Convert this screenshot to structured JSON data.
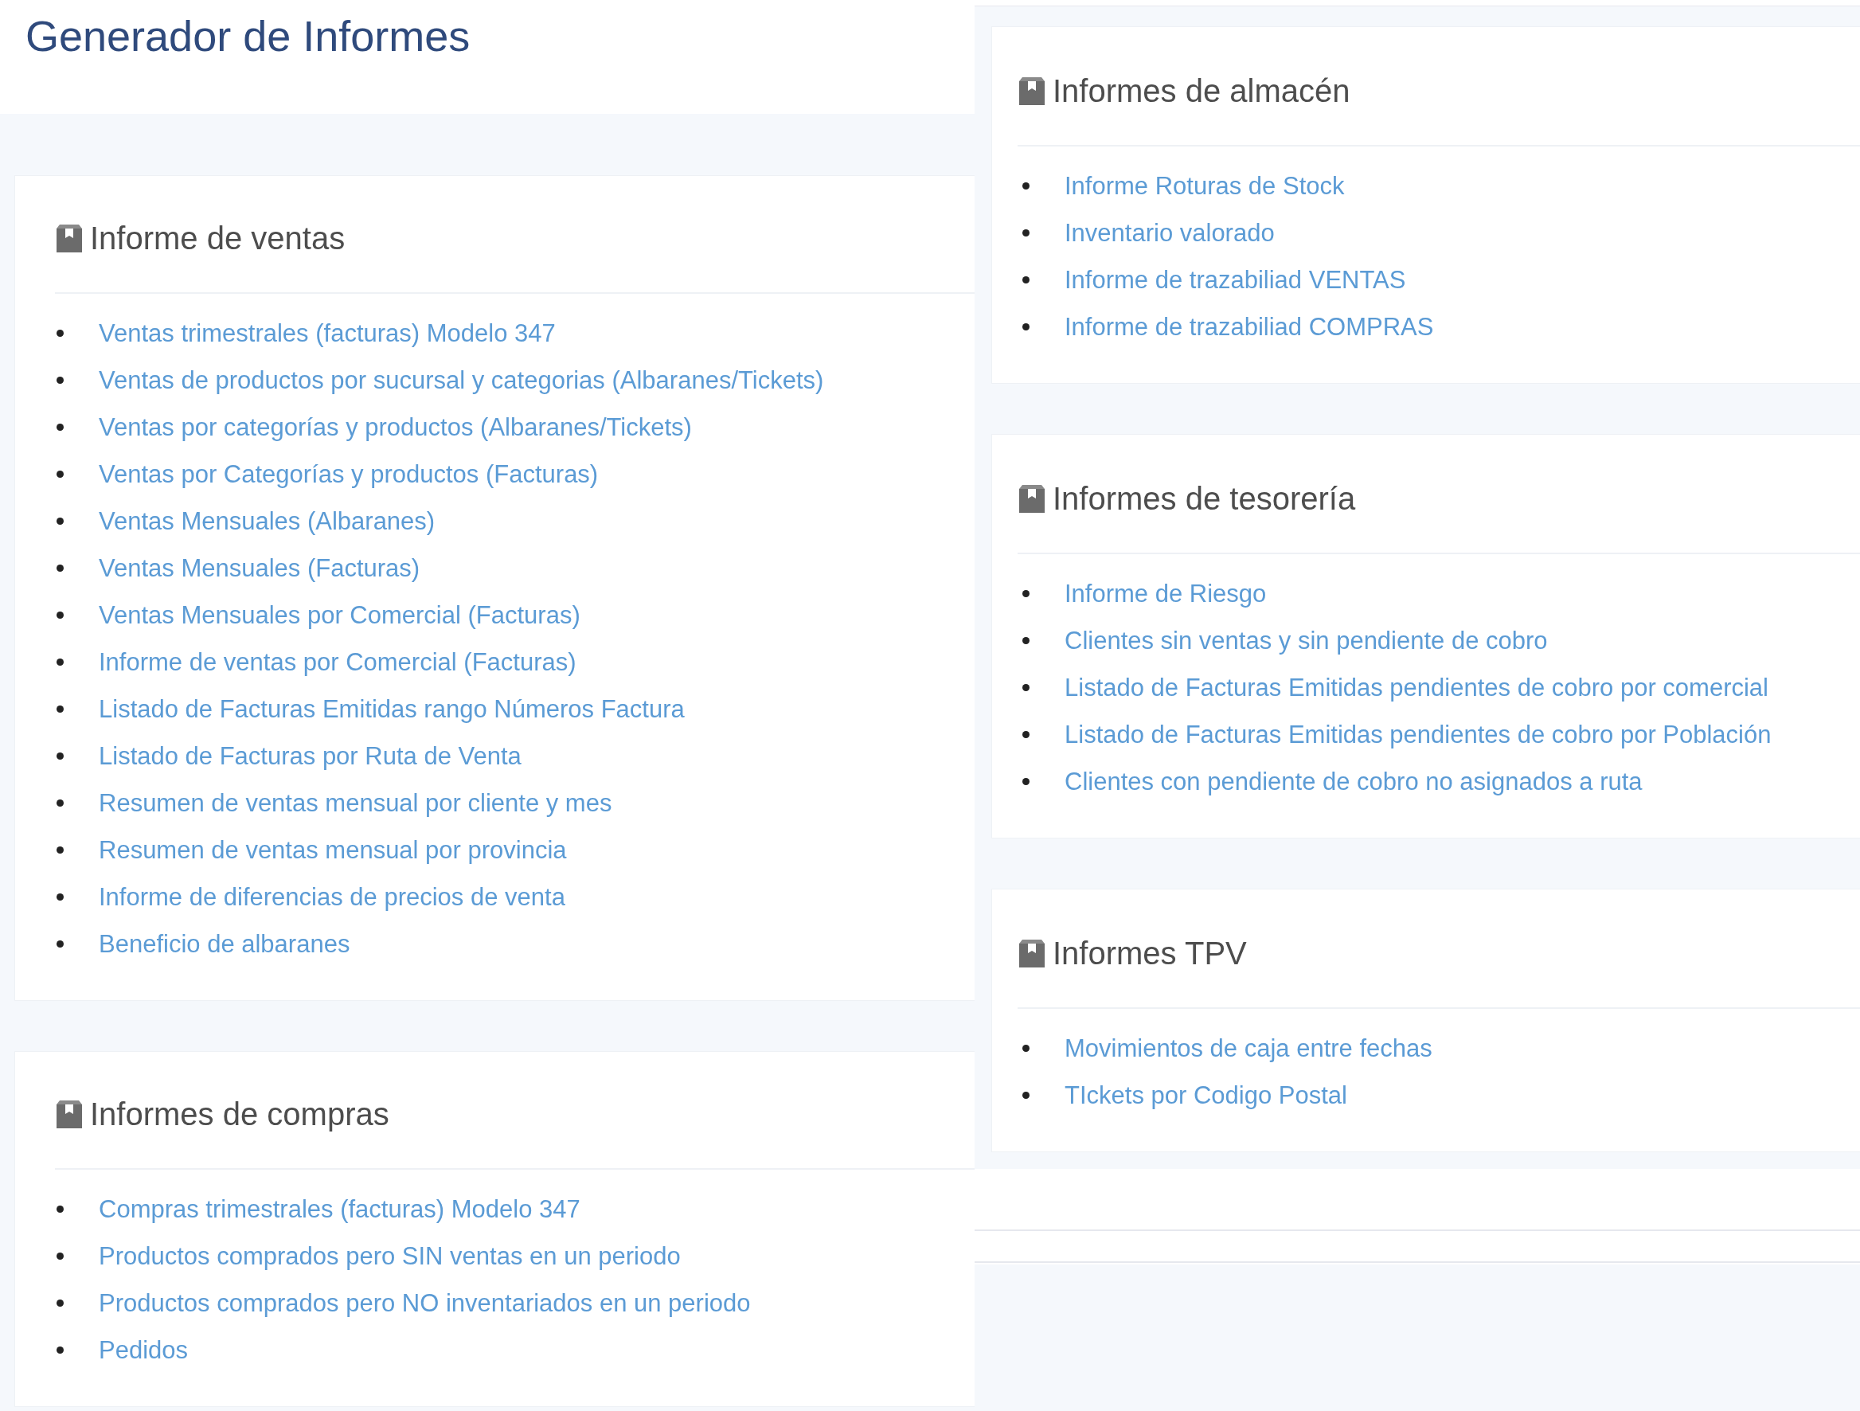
{
  "title": "Generador de Informes",
  "left_column": {
    "sections": [
      {
        "heading": "Informe de ventas",
        "links": [
          "Ventas trimestrales (facturas) Modelo 347",
          "Ventas de productos por sucursal y categorias (Albaranes/Tickets)",
          "Ventas por categorías y productos (Albaranes/Tickets)",
          "Ventas por Categorías y productos (Facturas)",
          "Ventas Mensuales (Albaranes)",
          "Ventas Mensuales (Facturas)",
          "Ventas Mensuales por Comercial (Facturas)",
          "Informe de ventas por Comercial (Facturas)",
          "Listado de Facturas Emitidas rango Números Factura",
          "Listado de Facturas por Ruta de Venta",
          "Resumen de ventas mensual por cliente y mes",
          "Resumen de ventas mensual por provincia",
          "Informe de diferencias de precios de venta",
          "Beneficio de albaranes"
        ]
      },
      {
        "heading": "Informes de compras",
        "links": [
          "Compras trimestrales (facturas) Modelo 347",
          "Productos comprados pero SIN ventas en un periodo",
          "Productos comprados pero NO inventariados en un periodo",
          "Pedidos"
        ]
      }
    ]
  },
  "right_column": {
    "sections": [
      {
        "heading": "Informes de almacén",
        "links": [
          "Informe Roturas de Stock",
          "Inventario valorado",
          "Informe de trazabiliad VENTAS",
          "Informe de trazabiliad COMPRAS"
        ]
      },
      {
        "heading": "Informes de tesorería",
        "links": [
          "Informe de Riesgo",
          "Clientes sin ventas y sin pendiente de cobro",
          "Listado de Facturas Emitidas pendientes de cobro por comercial",
          "Listado de Facturas Emitidas pendientes de cobro por Población",
          "Clientes con pendiente de cobro no asignados a ruta"
        ]
      },
      {
        "heading": "Informes TPV",
        "links": [
          "Movimientos de caja entre fechas",
          "TIckets por Codigo Postal"
        ]
      }
    ]
  }
}
